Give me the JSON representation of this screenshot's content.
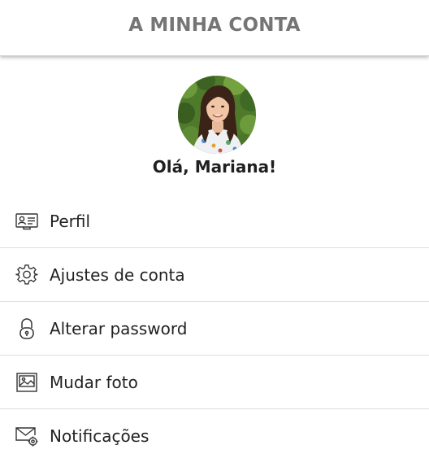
{
  "header": {
    "title": "A MINHA CONTA"
  },
  "profile": {
    "greeting": "Olá, Mariana!"
  },
  "menu": {
    "items": [
      {
        "label": "Perfil",
        "icon": "id-card-icon"
      },
      {
        "label": "Ajustes de conta",
        "icon": "gear-icon"
      },
      {
        "label": "Alterar password",
        "icon": "lock-icon"
      },
      {
        "label": "Mudar foto",
        "icon": "image-icon"
      },
      {
        "label": "Notificações",
        "icon": "mail-settings-icon"
      }
    ]
  },
  "colors": {
    "header_text": "#757575",
    "text": "#222222",
    "divider": "#dedede",
    "icon_stroke": "#333333"
  }
}
